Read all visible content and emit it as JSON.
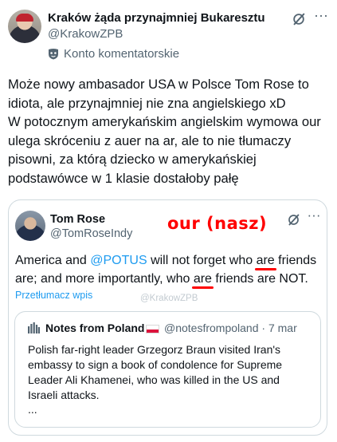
{
  "post": {
    "author_name": "Kraków żąda przynajmniej Bukaresztu",
    "author_handle": "@KrakowZPB",
    "badge_label": "Konto komentatorskie",
    "text": "Może nowy ambasador USA w Polsce Tom Rose to idiota, ale przynajmniej nie zna angielskiego xD\nW potocznym amerykańskim angielskim wymowa our ulega skróceniu z auer na ar, ale to nie tłumaczy pisowni, za którą dziecko w amerykańskiej podstawówce w 1 klasie dostałoby pałę",
    "icons": {
      "grok": "grok-icon",
      "more": "more-options-icon",
      "badge": "mask-icon"
    }
  },
  "quote": {
    "author_name": "Tom Rose",
    "author_handle": "@TomRoseIndy",
    "overlay_text": "our (nasz)",
    "text_parts": {
      "p1": "America and ",
      "mention": "@POTUS",
      "p2": " will not forget who ",
      "are1": "are",
      "p3": " friends are; and more importantly, who ",
      "are2": "are",
      "p4": " friends are NOT."
    },
    "translate_label": "Przetłumacz wpis",
    "watermark": "@KrakowZPB",
    "colors": {
      "accent": "#1d9bf0",
      "annotation": "#ff0000"
    }
  },
  "nested_quote": {
    "author_name": "Notes from Poland",
    "author_handle": "@notesfrompoland · 7 mar",
    "text": "Polish far-right leader Grzegorz Braun visited Iran's embassy to sign a book of condolence for Supreme Leader Ali Khamenei, who was killed in the US and Israeli attacks.",
    "ellipsis": "..."
  }
}
